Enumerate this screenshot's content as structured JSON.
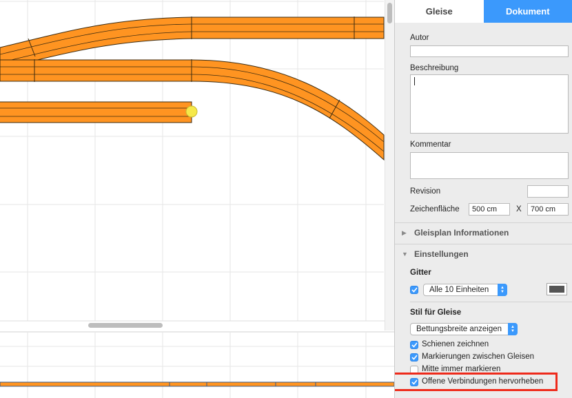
{
  "tabs": {
    "gleise": "Gleise",
    "dokument": "Dokument"
  },
  "document": {
    "author_label": "Autor",
    "author_value": "",
    "description_label": "Beschreibung",
    "description_value": "",
    "comment_label": "Kommentar",
    "comment_value": "",
    "revision_label": "Revision",
    "revision_value": "",
    "canvas_label": "Zeichenfläche",
    "canvas_width": "500 cm",
    "canvas_sep": "X",
    "canvas_height": "700 cm"
  },
  "sections": {
    "info": "Gleisplan Informationen",
    "settings": "Einstellungen"
  },
  "grid": {
    "label": "Gitter",
    "option": "Alle 10 Einheiten",
    "color": "#555555"
  },
  "track_style": {
    "label": "Stil für Gleise",
    "option": "Bettungsbreite anzeigen",
    "options": [
      {
        "label": "Schienen zeichnen",
        "checked": true
      },
      {
        "label": "Markierungen zwischen Gleisen",
        "checked": true
      },
      {
        "label": "Mitte immer markieren",
        "checked": false
      },
      {
        "label": "Offene Verbindungen hervorheben",
        "checked": true
      }
    ]
  },
  "colors": {
    "accent": "#3b99fc",
    "track": "#ff9421",
    "highlight": "#ee2a1b",
    "open_connection": "#f6e94a"
  }
}
